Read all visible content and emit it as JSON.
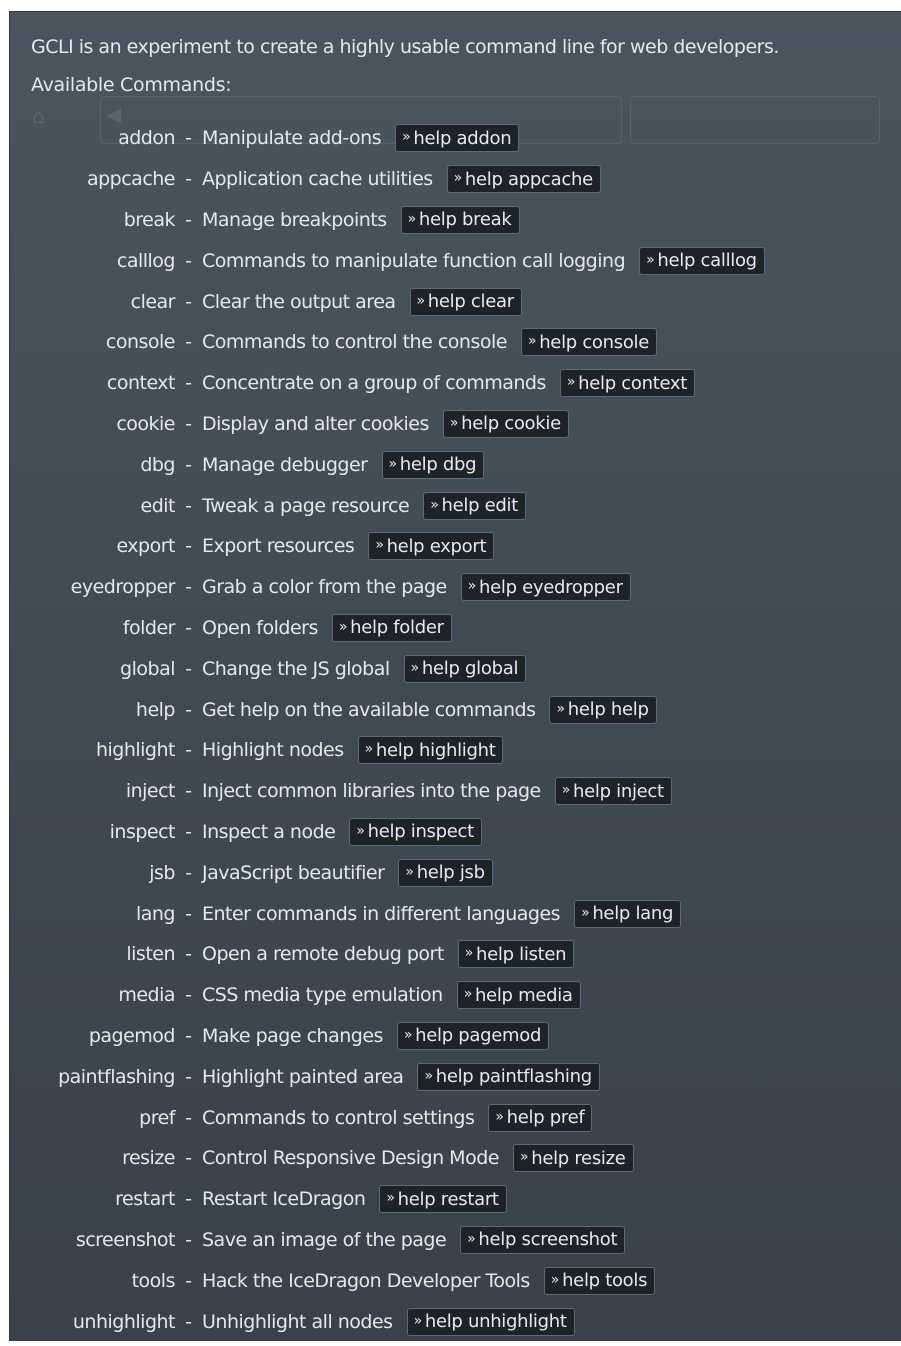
{
  "intro": "GCLI is an experiment to create a highly usable command line for web developers.",
  "available_label": "Available Commands:",
  "help_prefix": "»",
  "commands": [
    {
      "name": "addon",
      "desc": "Manipulate add-ons",
      "help": "help addon"
    },
    {
      "name": "appcache",
      "desc": "Application cache utilities",
      "help": "help appcache"
    },
    {
      "name": "break",
      "desc": "Manage breakpoints",
      "help": "help break"
    },
    {
      "name": "calllog",
      "desc": "Commands to manipulate function call logging",
      "help": "help calllog"
    },
    {
      "name": "clear",
      "desc": "Clear the output area",
      "help": "help clear"
    },
    {
      "name": "console",
      "desc": "Commands to control the console",
      "help": "help console"
    },
    {
      "name": "context",
      "desc": "Concentrate on a group of commands",
      "help": "help context"
    },
    {
      "name": "cookie",
      "desc": "Display and alter cookies",
      "help": "help cookie"
    },
    {
      "name": "dbg",
      "desc": "Manage debugger",
      "help": "help dbg"
    },
    {
      "name": "edit",
      "desc": "Tweak a page resource",
      "help": "help edit"
    },
    {
      "name": "export",
      "desc": "Export resources",
      "help": "help export"
    },
    {
      "name": "eyedropper",
      "desc": "Grab a color from the page",
      "help": "help eyedropper"
    },
    {
      "name": "folder",
      "desc": "Open folders",
      "help": "help folder"
    },
    {
      "name": "global",
      "desc": "Change the JS global",
      "help": "help global"
    },
    {
      "name": "help",
      "desc": "Get help on the available commands",
      "help": "help help"
    },
    {
      "name": "highlight",
      "desc": "Highlight nodes",
      "help": "help highlight"
    },
    {
      "name": "inject",
      "desc": "Inject common libraries into the page",
      "help": "help inject"
    },
    {
      "name": "inspect",
      "desc": "Inspect a node",
      "help": "help inspect"
    },
    {
      "name": "jsb",
      "desc": "JavaScript beautifier",
      "help": "help jsb"
    },
    {
      "name": "lang",
      "desc": "Enter commands in different languages",
      "help": "help lang"
    },
    {
      "name": "listen",
      "desc": "Open a remote debug port",
      "help": "help listen"
    },
    {
      "name": "media",
      "desc": "CSS media type emulation",
      "help": "help media"
    },
    {
      "name": "pagemod",
      "desc": "Make page changes",
      "help": "help pagemod"
    },
    {
      "name": "paintflashing",
      "desc": "Highlight painted area",
      "help": "help paintflashing"
    },
    {
      "name": "pref",
      "desc": "Commands to control settings",
      "help": "help pref"
    },
    {
      "name": "resize",
      "desc": "Control Responsive Design Mode",
      "help": "help resize"
    },
    {
      "name": "restart",
      "desc": "Restart IceDragon",
      "help": "help restart"
    },
    {
      "name": "screenshot",
      "desc": "Save an image of the page",
      "help": "help screenshot"
    },
    {
      "name": "tools",
      "desc": "Hack the IceDragon Developer Tools",
      "help": "help tools"
    },
    {
      "name": "unhighlight",
      "desc": "Unhighlight all nodes",
      "help": "help unhighlight"
    }
  ]
}
